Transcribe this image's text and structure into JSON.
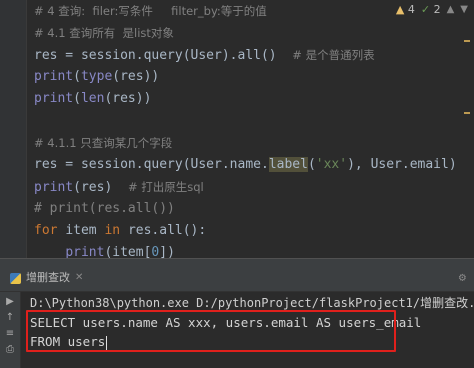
{
  "inspections": {
    "warnings": "4",
    "typos": "2"
  },
  "editor": {
    "lines": [
      {
        "tokens": [
          {
            "t": "# 4 查询:  filer:写条件     filter_by:等于的值",
            "c": "cmtcn"
          }
        ]
      },
      {
        "tokens": [
          {
            "t": "# 4.1 查询所有  是list对象",
            "c": "cmtcn"
          }
        ]
      },
      {
        "tokens": [
          {
            "t": "res = session.query(User).all()  ",
            "c": ""
          },
          {
            "t": "# 是个普通列表",
            "c": "cmtcn"
          }
        ]
      },
      {
        "tokens": [
          {
            "t": "print",
            "c": "bi"
          },
          {
            "t": "(",
            "c": ""
          },
          {
            "t": "type",
            "c": "bi"
          },
          {
            "t": "(res))",
            "c": ""
          }
        ]
      },
      {
        "tokens": [
          {
            "t": "print",
            "c": "bi"
          },
          {
            "t": "(",
            "c": ""
          },
          {
            "t": "len",
            "c": "bi"
          },
          {
            "t": "(res))",
            "c": ""
          }
        ]
      },
      {
        "tokens": []
      },
      {
        "tokens": [
          {
            "t": "# 4.1.1 只查询某几个字段",
            "c": "cmtcn"
          }
        ]
      },
      {
        "tokens": [
          {
            "t": "res = session.query(User.name.",
            "c": ""
          },
          {
            "t": "label",
            "c": "hl"
          },
          {
            "t": "(",
            "c": ""
          },
          {
            "t": "'xx'",
            "c": "str"
          },
          {
            "t": "), User.email)",
            "c": ""
          }
        ]
      },
      {
        "tokens": [
          {
            "t": "print",
            "c": "bi"
          },
          {
            "t": "(res)  ",
            "c": ""
          },
          {
            "t": "# 打出原生sql",
            "c": "cmtcn"
          }
        ]
      },
      {
        "tokens": [
          {
            "t": "# print(res.all())",
            "c": "cmt"
          }
        ]
      },
      {
        "tokens": [
          {
            "t": "for ",
            "c": "kw"
          },
          {
            "t": "item ",
            "c": ""
          },
          {
            "t": "in ",
            "c": "kw"
          },
          {
            "t": "res.all():",
            "c": ""
          }
        ]
      },
      {
        "tokens": [
          {
            "t": "    ",
            "c": ""
          },
          {
            "t": "print",
            "c": "bi"
          },
          {
            "t": "(item[",
            "c": ""
          },
          {
            "t": "0",
            "c": "num"
          },
          {
            "t": "])",
            "c": ""
          }
        ]
      }
    ]
  },
  "run_panel": {
    "tab_label": "增删查改",
    "console_lines": [
      "D:\\Python38\\python.exe D:/pythonProject/flaskProject1/增删查改.py",
      "SELECT users.name AS xxx, users.email AS users_email",
      "FROM users"
    ]
  },
  "colors": {
    "highlight_box": "#e0201c",
    "warning": "#e8bf6a"
  }
}
